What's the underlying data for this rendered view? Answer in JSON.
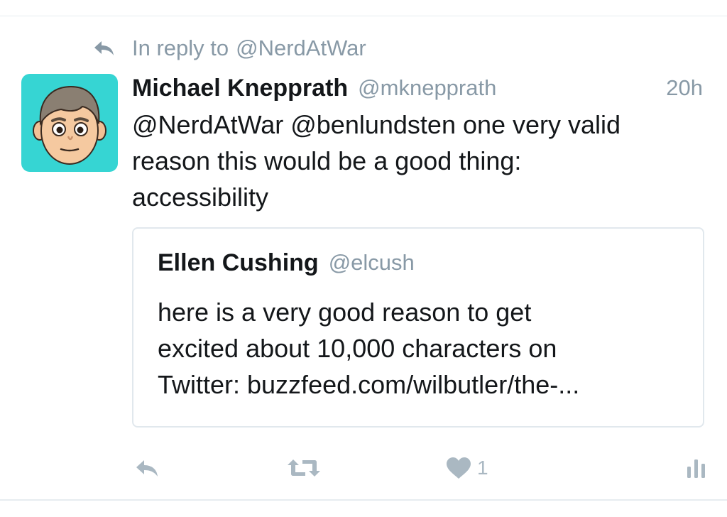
{
  "reply_context": {
    "prefix": "In reply to",
    "mention": "@NerdAtWar"
  },
  "tweet": {
    "author_name": "Michael Knepprath",
    "author_handle": "@mknepprath",
    "timestamp": "20h",
    "text_lines": [
      "@NerdAtWar @benlundsten one very valid",
      "reason this would be a good thing:",
      "accessibility"
    ]
  },
  "quoted_tweet": {
    "author_name": "Ellen Cushing",
    "author_handle": "@elcush",
    "text_lines": [
      "here is a very good reason to get",
      "excited about 10,000 characters on",
      "Twitter: buzzfeed.com/wilbutler/the-..."
    ]
  },
  "actions": {
    "reply_icon": "reply-arrow",
    "retweet_icon": "retweet-arrows",
    "like_icon": "heart",
    "like_count": "1",
    "analytics_icon": "bar-chart"
  },
  "colors": {
    "avatar_bg": "#36d5d3",
    "muted": "#8899a6",
    "action_icon": "#aab8c2",
    "text": "#14171a"
  }
}
